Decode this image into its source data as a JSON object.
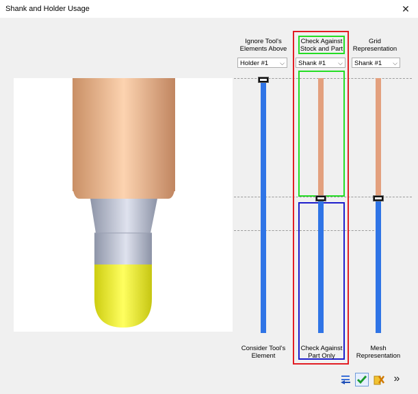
{
  "window": {
    "title": "Shank and Holder Usage",
    "close_glyph": "✕"
  },
  "columns": {
    "ignore": {
      "header": "Ignore Tool's\nElements Above",
      "dropdown": "Holder #1",
      "footer": "Consider Tool's\nElement"
    },
    "check": {
      "header": "Check Against\nStock and Part",
      "dropdown": "Shank #1",
      "footer": "Check Against\nPart Only"
    },
    "grid": {
      "header": "Grid\nRepresentation",
      "dropdown": "Shank #1",
      "footer": "Mesh\nRepresentation"
    }
  },
  "dropdown_arrow": "⌵",
  "buttons": {
    "more_glyph": "»"
  },
  "icons": [
    "swap-icon",
    "checkmark-icon",
    "close-cancel-icon",
    "chevron-double-right-icon"
  ],
  "colors": {
    "track_blue": "#2f74e6",
    "track_orange": "#e3a07e",
    "red_box": "#e21c23",
    "green_box": "#22dd22",
    "blue_box": "#1c1ccc",
    "shank_yellow": "#ecec2a"
  }
}
